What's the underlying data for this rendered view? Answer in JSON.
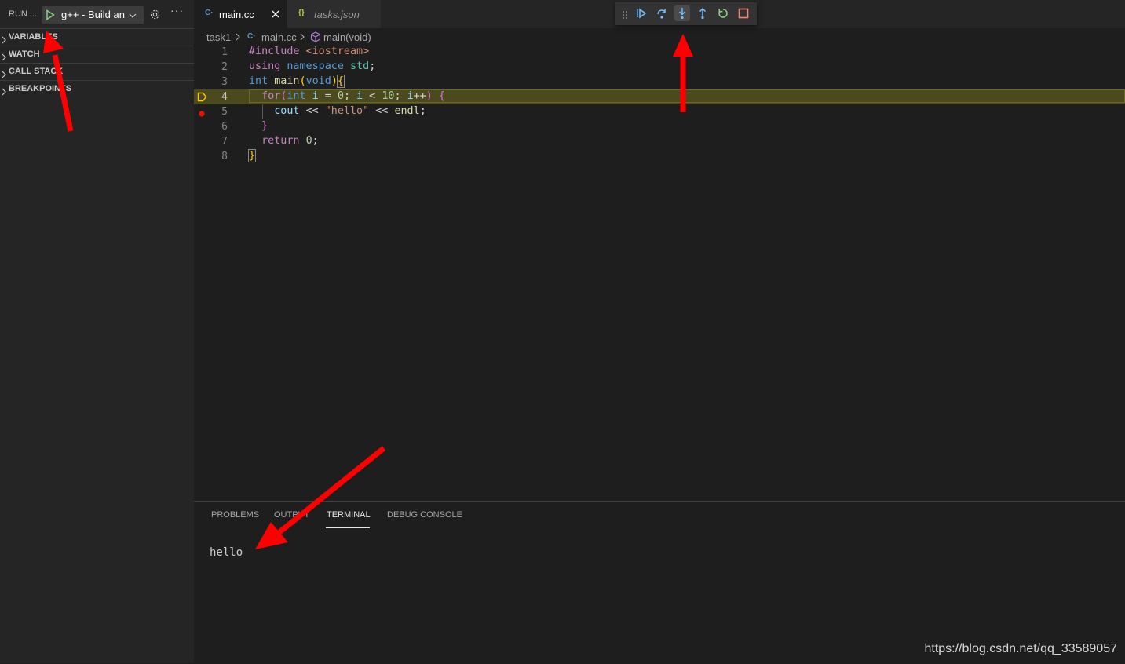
{
  "sidebar": {
    "title": "RUN ...",
    "run_config": "g++ - Build an",
    "sections": [
      "VARIABLES",
      "WATCH",
      "CALL STACK",
      "BREAKPOINTS"
    ]
  },
  "tabs": [
    {
      "label": "main.cc",
      "icon": "C·",
      "active": true
    },
    {
      "label": "tasks.json",
      "icon": "{}",
      "active": false
    }
  ],
  "debug_toolbar": {
    "buttons": [
      "continue",
      "step-over",
      "step-into",
      "step-out",
      "restart",
      "stop"
    ],
    "selected": "step-into"
  },
  "breadcrumb": {
    "folder": "task1",
    "file": "main.cc",
    "symbol": "main(void)"
  },
  "code": {
    "line_numbers": [
      "1",
      "2",
      "3",
      "4",
      "5",
      "6",
      "7",
      "8"
    ],
    "current_line": 4,
    "breakpoint_line": 5,
    "lines": [
      "#include <iostream>",
      "using namespace std;",
      "int main(void){",
      "  for(int i = 0; i < 10; i++) {",
      "    cout << \"hello\" << endl;",
      "  }",
      "  return 0;",
      "}"
    ]
  },
  "panel": {
    "tabs": [
      "PROBLEMS",
      "OUTPUT",
      "TERMINAL",
      "DEBUG CONSOLE"
    ],
    "active_tab": "TERMINAL",
    "terminal_output": "hello"
  },
  "watermark": "https://blog.csdn.net/qq_33589057",
  "colors": {
    "annotation_arrow": "#ff0000",
    "current_line_bg": "#4b4a1f",
    "breakpoint": "#e51400"
  }
}
